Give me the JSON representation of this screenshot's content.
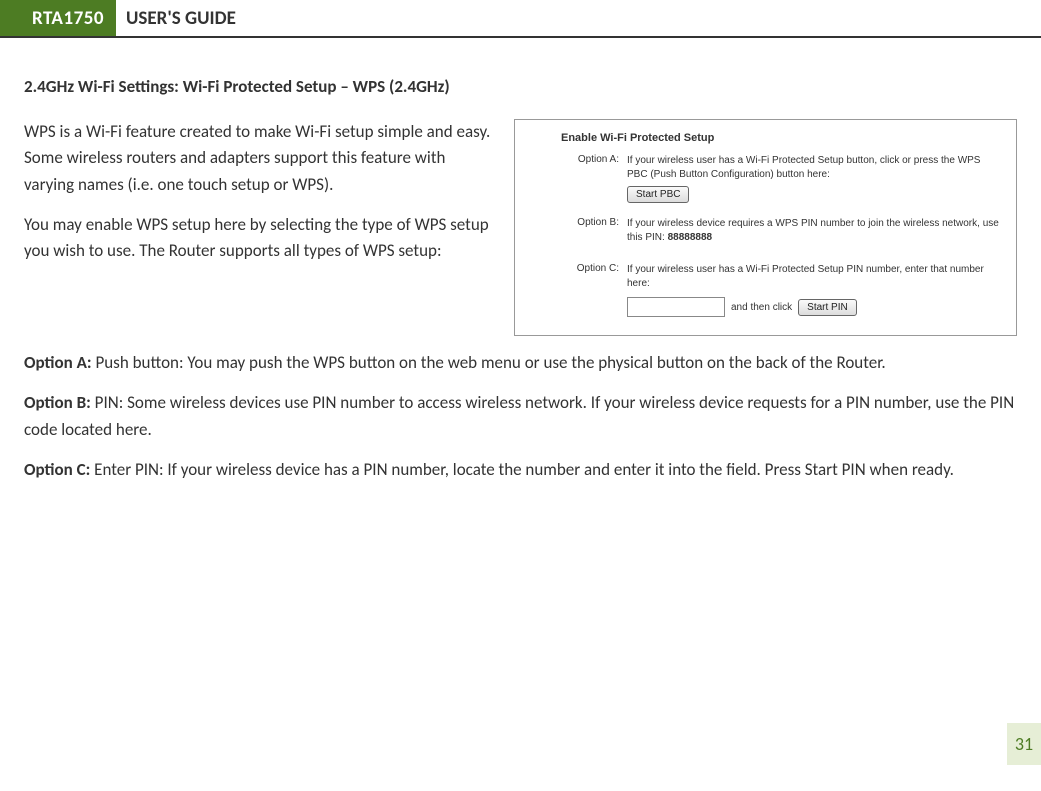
{
  "header": {
    "model": "RTA1750",
    "title": "USER'S GUIDE"
  },
  "section_heading": "2.4GHz Wi-Fi Settings: Wi-Fi Protected Setup – WPS (2.4GHz)",
  "intro": {
    "p1": "WPS is a Wi-Fi feature created to make Wi-Fi setup simple and easy.  Some wireless routers and adapters support this feature with varying names (i.e. one touch setup or WPS).",
    "p2": "You may enable WPS setup here by selecting the type of WPS setup you wish to use.  The Router supports all types of WPS setup:"
  },
  "options": {
    "a": {
      "label": "Option A:",
      "text": " Push button: You may push the WPS button on the web menu or use the physical button on the back of the Router."
    },
    "b": {
      "label": "Option B:",
      "text": " PIN: Some wireless devices use PIN number to access wireless network.  If your wireless device requests for a PIN number, use the PIN code located here."
    },
    "c": {
      "label": "Option C:",
      "text": " Enter PIN: If your wireless device has a PIN number, locate the number and enter it into the field.  Press Start PIN when ready."
    }
  },
  "panel": {
    "title": "Enable Wi-Fi Protected Setup",
    "a": {
      "label": "Option A:",
      "desc": "If your wireless user has a Wi-Fi Protected Setup button, click or press the WPS PBC (Push Button Configuration) button here:",
      "button": "Start PBC"
    },
    "b": {
      "label": "Option B:",
      "desc_prefix": "If your wireless device requires a WPS PIN number to join the wireless network, use this PIN: ",
      "pin": "88888888"
    },
    "c": {
      "label": "Option C:",
      "desc": "If your wireless user has a Wi-Fi Protected Setup PIN number, enter that number here:",
      "and_then": "and then click",
      "button": "Start PIN"
    }
  },
  "page_number": "31"
}
